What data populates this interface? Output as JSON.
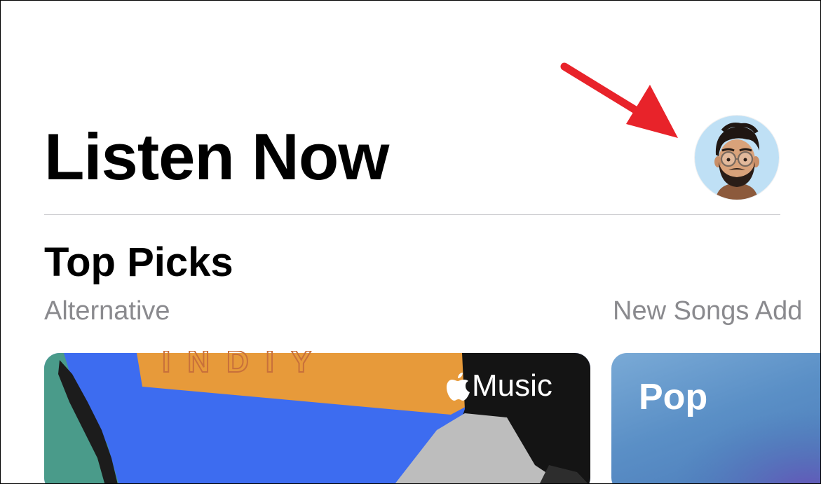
{
  "header": {
    "title": "Listen Now",
    "avatar_icon": "memoji-avatar-icon"
  },
  "section": {
    "title": "Top Picks",
    "cards": [
      {
        "subtitle": "Alternative",
        "badge": "Music",
        "badge_icon": "apple-logo-icon",
        "art_text": "INDIY"
      },
      {
        "subtitle": "New Songs Add",
        "label": "Pop"
      }
    ]
  },
  "annotation": {
    "arrow_color": "#e8232a"
  },
  "colors": {
    "background": "#ffffff",
    "subtitle_text": "#8a8a8e",
    "divider": "#c8c8cc"
  }
}
